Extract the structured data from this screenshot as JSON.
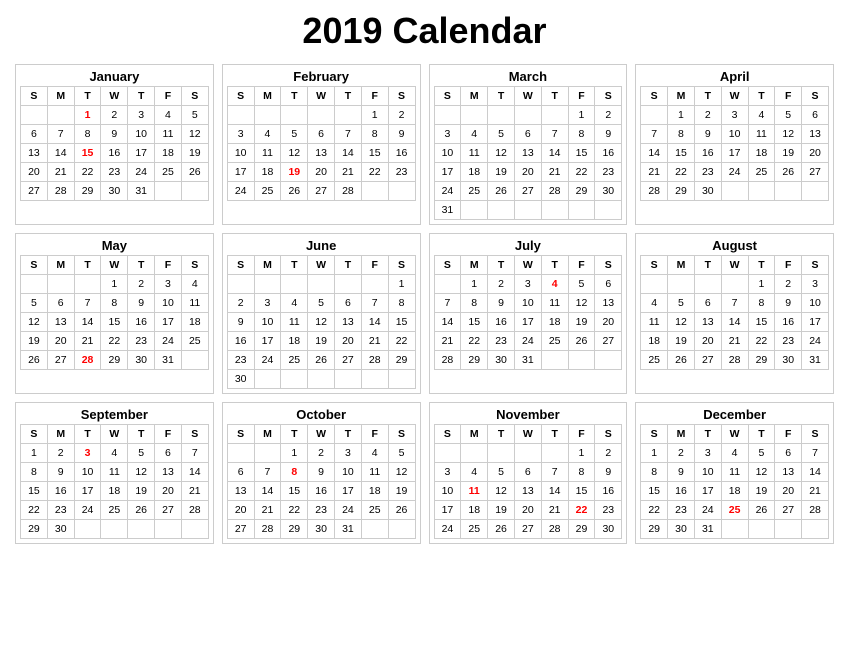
{
  "title": "2019 Calendar",
  "months": [
    {
      "name": "January",
      "headers": [
        "S",
        "M",
        "T",
        "W",
        "T",
        "F",
        "S"
      ],
      "weeks": [
        [
          "",
          "",
          "1",
          "2",
          "3",
          "4",
          "5"
        ],
        [
          "6",
          "7",
          "8",
          "9",
          "10",
          "11",
          "12"
        ],
        [
          "13",
          "14",
          "15",
          "16",
          "17",
          "18",
          "19"
        ],
        [
          "20",
          "21",
          "22",
          "23",
          "24",
          "25",
          "26"
        ],
        [
          "27",
          "28",
          "29",
          "30",
          "31",
          "",
          ""
        ]
      ],
      "reds": [
        "1",
        "15"
      ]
    },
    {
      "name": "February",
      "headers": [
        "S",
        "M",
        "T",
        "W",
        "T",
        "F",
        "S"
      ],
      "weeks": [
        [
          "",
          "",
          "",
          "",
          "",
          "1",
          "2"
        ],
        [
          "3",
          "4",
          "5",
          "6",
          "7",
          "8",
          "9"
        ],
        [
          "10",
          "11",
          "12",
          "13",
          "14",
          "15",
          "16"
        ],
        [
          "17",
          "18",
          "19",
          "20",
          "21",
          "22",
          "23"
        ],
        [
          "24",
          "25",
          "26",
          "27",
          "28",
          "",
          ""
        ]
      ],
      "reds": [
        "19"
      ]
    },
    {
      "name": "March",
      "headers": [
        "S",
        "M",
        "T",
        "W",
        "T",
        "F",
        "S"
      ],
      "weeks": [
        [
          "",
          "",
          "",
          "",
          "",
          "1",
          "2"
        ],
        [
          "3",
          "4",
          "5",
          "6",
          "7",
          "8",
          "9"
        ],
        [
          "10",
          "11",
          "12",
          "13",
          "14",
          "15",
          "16"
        ],
        [
          "17",
          "18",
          "19",
          "20",
          "21",
          "22",
          "23"
        ],
        [
          "24",
          "25",
          "26",
          "27",
          "28",
          "29",
          "30"
        ],
        [
          "31",
          "",
          "",
          "",
          "",
          "",
          ""
        ]
      ],
      "reds": []
    },
    {
      "name": "April",
      "headers": [
        "S",
        "M",
        "T",
        "W",
        "T",
        "F",
        "S"
      ],
      "weeks": [
        [
          "",
          "1",
          "2",
          "3",
          "4",
          "5",
          "6"
        ],
        [
          "7",
          "8",
          "9",
          "10",
          "11",
          "12",
          "13"
        ],
        [
          "14",
          "15",
          "16",
          "17",
          "18",
          "19",
          "20"
        ],
        [
          "21",
          "22",
          "23",
          "24",
          "25",
          "26",
          "27"
        ],
        [
          "28",
          "29",
          "30",
          "",
          "",
          "",
          ""
        ]
      ],
      "reds": []
    },
    {
      "name": "May",
      "headers": [
        "S",
        "M",
        "T",
        "W",
        "T",
        "F",
        "S"
      ],
      "weeks": [
        [
          "",
          "",
          "",
          "1",
          "2",
          "3",
          "4"
        ],
        [
          "5",
          "6",
          "7",
          "8",
          "9",
          "10",
          "11"
        ],
        [
          "12",
          "13",
          "14",
          "15",
          "16",
          "17",
          "18"
        ],
        [
          "19",
          "20",
          "21",
          "22",
          "23",
          "24",
          "25"
        ],
        [
          "26",
          "27",
          "28",
          "29",
          "30",
          "31",
          ""
        ]
      ],
      "reds": [
        "28"
      ]
    },
    {
      "name": "June",
      "headers": [
        "S",
        "M",
        "T",
        "W",
        "T",
        "F",
        "S"
      ],
      "weeks": [
        [
          "",
          "",
          "",
          "",
          "",
          "",
          "1"
        ],
        [
          "2",
          "3",
          "4",
          "5",
          "6",
          "7",
          "8"
        ],
        [
          "9",
          "10",
          "11",
          "12",
          "13",
          "14",
          "15"
        ],
        [
          "16",
          "17",
          "18",
          "19",
          "20",
          "21",
          "22"
        ],
        [
          "23",
          "24",
          "25",
          "26",
          "27",
          "28",
          "29"
        ],
        [
          "30",
          "",
          "",
          "",
          "",
          "",
          ""
        ]
      ],
      "reds": []
    },
    {
      "name": "July",
      "headers": [
        "S",
        "M",
        "T",
        "W",
        "T",
        "F",
        "S"
      ],
      "weeks": [
        [
          "",
          "1",
          "2",
          "3",
          "4",
          "5",
          "6"
        ],
        [
          "7",
          "8",
          "9",
          "10",
          "11",
          "12",
          "13"
        ],
        [
          "14",
          "15",
          "16",
          "17",
          "18",
          "19",
          "20"
        ],
        [
          "21",
          "22",
          "23",
          "24",
          "25",
          "26",
          "27"
        ],
        [
          "28",
          "29",
          "30",
          "31",
          "",
          "",
          ""
        ]
      ],
      "reds": [
        "4"
      ]
    },
    {
      "name": "August",
      "headers": [
        "S",
        "M",
        "T",
        "W",
        "T",
        "F",
        "S"
      ],
      "weeks": [
        [
          "",
          "",
          "",
          "",
          "1",
          "2",
          "3"
        ],
        [
          "4",
          "5",
          "6",
          "7",
          "8",
          "9",
          "10"
        ],
        [
          "11",
          "12",
          "13",
          "14",
          "15",
          "16",
          "17"
        ],
        [
          "18",
          "19",
          "20",
          "21",
          "22",
          "23",
          "24"
        ],
        [
          "25",
          "26",
          "27",
          "28",
          "29",
          "30",
          "31"
        ]
      ],
      "reds": []
    },
    {
      "name": "September",
      "headers": [
        "S",
        "M",
        "T",
        "W",
        "T",
        "F",
        "S"
      ],
      "weeks": [
        [
          "1",
          "2",
          "3",
          "4",
          "5",
          "6",
          "7"
        ],
        [
          "8",
          "9",
          "10",
          "11",
          "12",
          "13",
          "14"
        ],
        [
          "15",
          "16",
          "17",
          "18",
          "19",
          "20",
          "21"
        ],
        [
          "22",
          "23",
          "24",
          "25",
          "26",
          "27",
          "28"
        ],
        [
          "29",
          "30",
          "",
          "",
          "",
          "",
          ""
        ]
      ],
      "reds": [
        "3"
      ]
    },
    {
      "name": "October",
      "headers": [
        "S",
        "M",
        "T",
        "W",
        "T",
        "F",
        "S"
      ],
      "weeks": [
        [
          "",
          "",
          "1",
          "2",
          "3",
          "4",
          "5"
        ],
        [
          "6",
          "7",
          "8",
          "9",
          "10",
          "11",
          "12"
        ],
        [
          "13",
          "14",
          "15",
          "16",
          "17",
          "18",
          "19"
        ],
        [
          "20",
          "21",
          "22",
          "23",
          "24",
          "25",
          "26"
        ],
        [
          "27",
          "28",
          "29",
          "30",
          "31",
          "",
          ""
        ]
      ],
      "reds": [
        "8"
      ]
    },
    {
      "name": "November",
      "headers": [
        "S",
        "M",
        "T",
        "W",
        "T",
        "F",
        "S"
      ],
      "weeks": [
        [
          "",
          "",
          "",
          "",
          "",
          "1",
          "2"
        ],
        [
          "3",
          "4",
          "5",
          "6",
          "7",
          "8",
          "9"
        ],
        [
          "10",
          "11",
          "12",
          "13",
          "14",
          "15",
          "16"
        ],
        [
          "17",
          "18",
          "19",
          "20",
          "21",
          "22",
          "23"
        ],
        [
          "24",
          "25",
          "26",
          "27",
          "28",
          "29",
          "30"
        ]
      ],
      "reds": [
        "11",
        "22"
      ]
    },
    {
      "name": "December",
      "headers": [
        "S",
        "M",
        "T",
        "W",
        "T",
        "F",
        "S"
      ],
      "weeks": [
        [
          "1",
          "2",
          "3",
          "4",
          "5",
          "6",
          "7"
        ],
        [
          "8",
          "9",
          "10",
          "11",
          "12",
          "13",
          "14"
        ],
        [
          "15",
          "16",
          "17",
          "18",
          "19",
          "20",
          "21"
        ],
        [
          "22",
          "23",
          "24",
          "25",
          "26",
          "27",
          "28"
        ],
        [
          "29",
          "30",
          "31",
          "",
          "",
          "",
          ""
        ]
      ],
      "reds": [
        "25"
      ]
    }
  ]
}
